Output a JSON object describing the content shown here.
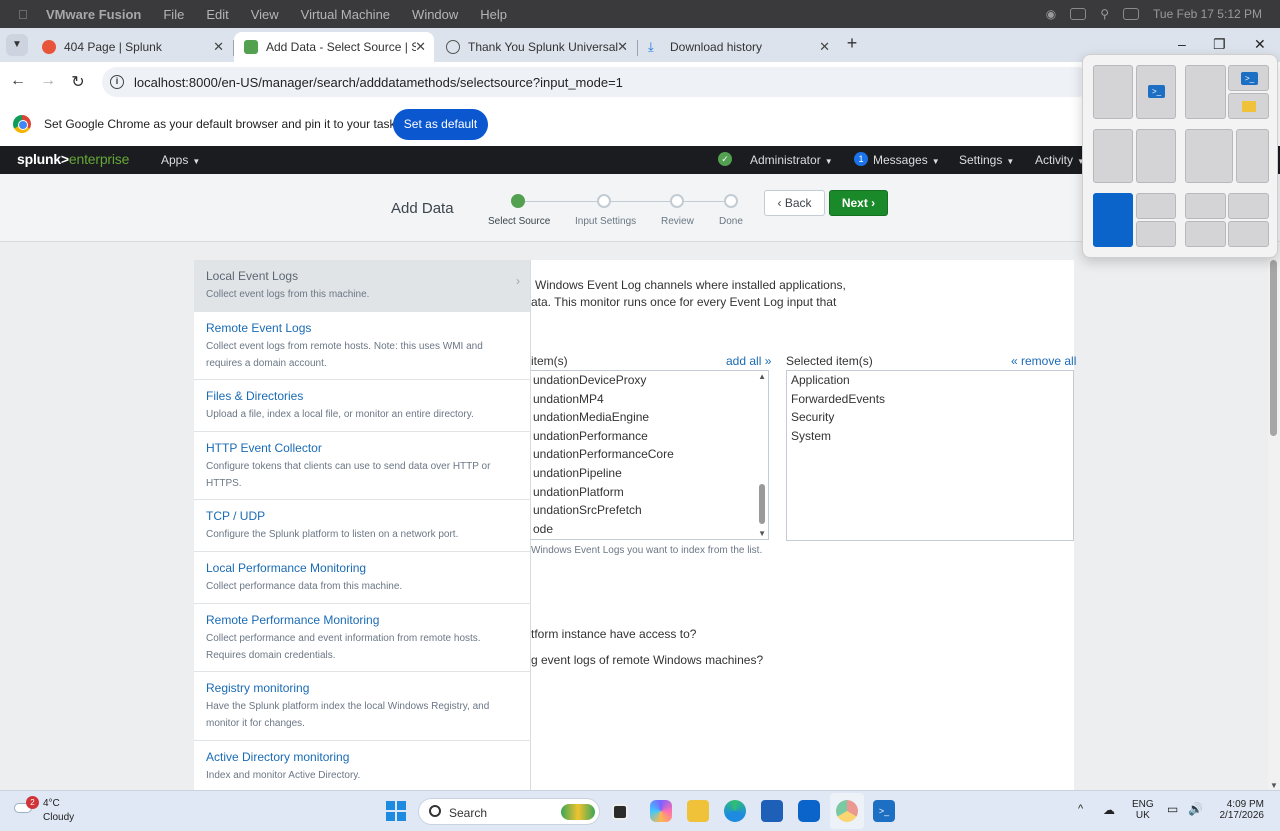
{
  "macos_menubar": {
    "app_name": "VMware Fusion",
    "menus": [
      "File",
      "Edit",
      "View",
      "Virtual Machine",
      "Window",
      "Help"
    ],
    "datetime": "Tue Feb 17  5:12 PM"
  },
  "browser": {
    "tabs": [
      {
        "title": "404 Page | Splunk",
        "active": false
      },
      {
        "title": "Add Data - Select Source | Splu",
        "active": true
      },
      {
        "title": "Thank You Splunk Universal For",
        "active": false
      },
      {
        "title": "Download history",
        "active": false
      }
    ],
    "url": "localhost:8000/en-US/manager/search/adddatamethods/selectsource?input_mode=1",
    "default_banner": {
      "message": "Set Google Chrome as your default browser and pin it to your taskbar",
      "button": "Set as default"
    },
    "window_controls": [
      "–",
      "❐",
      "✕"
    ]
  },
  "splunk_bar": {
    "logo_main": "splunk>",
    "logo_sub": "enterprise",
    "apps": "Apps",
    "user": "Administrator",
    "messages_count": "1",
    "messages": "Messages",
    "settings": "Settings",
    "activity": "Activity"
  },
  "wizard": {
    "title": "Add Data",
    "steps": [
      "Select Source",
      "Input Settings",
      "Review",
      "Done"
    ],
    "current_step": 1,
    "back": "Back",
    "next": "Next"
  },
  "sources": [
    {
      "name": "Local Event Logs",
      "desc": "Collect event logs from this machine.",
      "selected": true
    },
    {
      "name": "Remote Event Logs",
      "desc": "Collect event logs from remote hosts. Note: this uses WMI and requires a domain account.",
      "selected": false
    },
    {
      "name": "Files & Directories",
      "desc": "Upload a file, index a local file, or monitor an entire directory.",
      "selected": false
    },
    {
      "name": "HTTP Event Collector",
      "desc": "Configure tokens that clients can use to send data over HTTP or HTTPS.",
      "selected": false
    },
    {
      "name": "TCP / UDP",
      "desc": "Configure the Splunk platform to listen on a network port.",
      "selected": false
    },
    {
      "name": "Local Performance Monitoring",
      "desc": "Collect performance data from this machine.",
      "selected": false
    },
    {
      "name": "Remote Performance Monitoring",
      "desc": "Collect performance and event information from remote hosts. Requires domain credentials.",
      "selected": false
    },
    {
      "name": "Registry monitoring",
      "desc": "Have the Splunk platform index the local Windows Registry, and monitor it for changes.",
      "selected": false
    },
    {
      "name": "Active Directory monitoring",
      "desc": "Index and monitor Active Directory.",
      "selected": false
    }
  ],
  "detail": {
    "intro_line1": "Windows Event Log channels where installed applications,",
    "intro_line2": "ata. This monitor runs once for every Event Log input that",
    "available_label": "item(s)",
    "add_all": "add all »",
    "selected_label": "Selected item(s)",
    "remove_all": "« remove all",
    "available_items": [
      "undationDeviceProxy",
      "undationMP4",
      "undationMediaEngine",
      "undationPerformance",
      "undationPerformanceCore",
      "undationPipeline",
      "undationPlatform",
      "undationSrcPrefetch",
      "ode"
    ],
    "selected_items": [
      "Application",
      "ForwardedEvents",
      "Security",
      "System"
    ],
    "hint": "Windows Event Logs you want to index from the list.",
    "faq1": "tform instance have access to?",
    "faq2": "g event logs of remote Windows machines?"
  },
  "taskbar": {
    "weather_badge": "2",
    "temperature": "4°C",
    "condition": "Cloudy",
    "search": "Search",
    "lang1": "ENG",
    "lang2": "UK",
    "time": "4:09 PM",
    "date": "2/17/2026"
  }
}
